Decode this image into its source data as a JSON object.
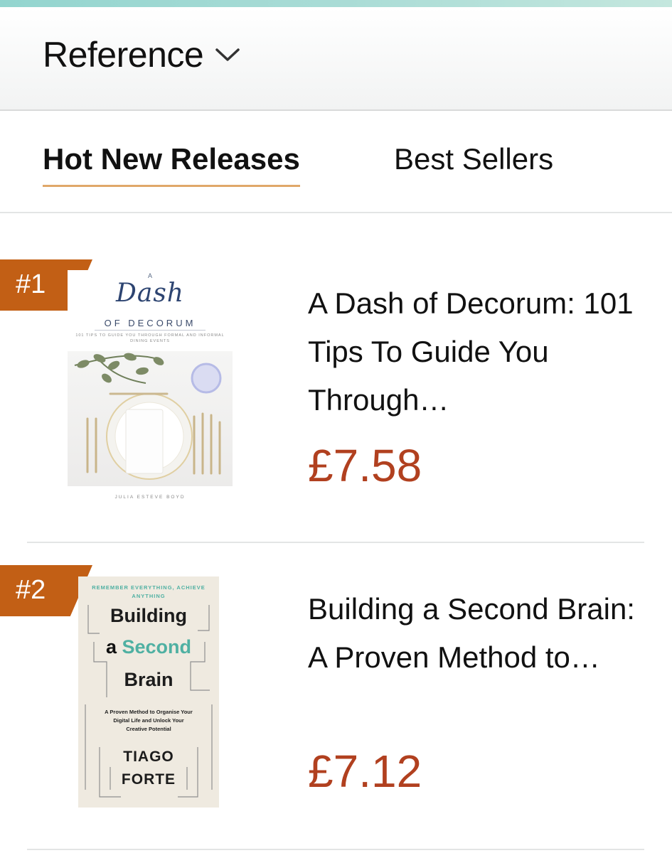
{
  "header": {
    "title": "Reference"
  },
  "tabs": [
    {
      "label": "Hot New Releases",
      "active": true
    },
    {
      "label": "Best Sellers",
      "active": false
    }
  ],
  "items": [
    {
      "rank": "#1",
      "title": "A Dash of Decorum: 101 Tips To Guide You Through…",
      "price": "£7.58",
      "cover": {
        "top": "A",
        "script": "Dash",
        "subtitle": "OF DECORUM",
        "tagline": "101 TIPS TO GUIDE YOU THROUGH FORMAL AND INFORMAL DINING EVENTS",
        "author": "JULIA ESTEVE BOYD"
      }
    },
    {
      "rank": "#2",
      "title": "Building a Second Brain: A Proven Method to…",
      "price": "£7.12",
      "cover": {
        "tagline": "REMEMBER EVERYTHING, ACHIEVE ANYTHING",
        "line1": "Building",
        "line2_a": "a ",
        "line2_b": "Second",
        "line3": "Brain",
        "description": "A Proven Method to Organise Your Digital Life and Unlock Your Creative Potential",
        "author_first": "TIAGO",
        "author_last": "FORTE"
      }
    }
  ],
  "colors": {
    "accent_underline": "#e0a869",
    "rank_badge": "#c25f15",
    "price": "#b1401f",
    "top_accent": "#93d5cf"
  },
  "icons": [
    "chevron-down-icon"
  ]
}
